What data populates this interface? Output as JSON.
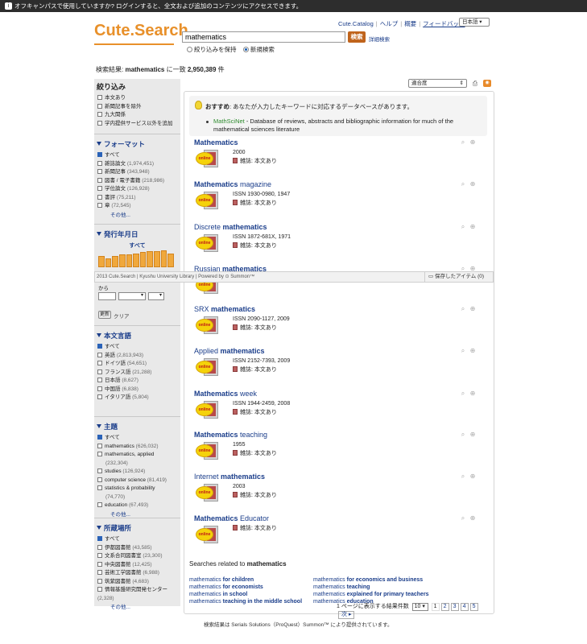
{
  "topbar": {
    "text": "オフキャンパスで使用していますか? ログインすると、全文および追加のコンテンツにアクセスできます。"
  },
  "header": {
    "logo": "Cute.Search",
    "search_value": "mathematics",
    "search_button": "検索",
    "advanced": "詳細検索",
    "radio_keep": "絞り込みを保持",
    "radio_new": "新規検索",
    "nav": [
      "Cute.Catalog",
      "ヘルプ",
      "概要",
      "フィードバック"
    ],
    "lang": "日本語"
  },
  "result_count": {
    "prefix": "検索結果: ",
    "query": "mathematics",
    "mid": " に一致 ",
    "count": "2,950,389",
    "suffix": " 件"
  },
  "sidebar": {
    "refine_title": "絞り込み",
    "refine_items": [
      "本文あり",
      "新聞記事を除外",
      "九大関係",
      "学内提供サービス以外を追加"
    ],
    "format": {
      "title": "フォーマット",
      "items": [
        {
          "label": "すべて",
          "count": "",
          "checked": true
        },
        {
          "label": "雑誌論文",
          "count": "(1,974,451)",
          "checked": false
        },
        {
          "label": "新聞記事",
          "count": "(343,948)",
          "checked": false
        },
        {
          "label": "図書 / 電子書籍",
          "count": "(218,986)",
          "checked": false
        },
        {
          "label": "学位論文",
          "count": "(126,928)",
          "checked": false
        },
        {
          "label": "書評",
          "count": "(75,211)",
          "checked": false
        },
        {
          "label": "章",
          "count": "(72,545)",
          "checked": false
        }
      ],
      "more": "その他..."
    },
    "date": {
      "title": "発行年月日",
      "all": "すべて",
      "from": "から",
      "update": "更新",
      "clear": "クリア",
      "histogram": [
        0.55,
        0.45,
        0.55,
        0.65,
        0.65,
        0.7,
        0.75,
        0.8,
        0.8,
        0.85,
        0.7
      ]
    },
    "language": {
      "title": "本文言語",
      "items": [
        {
          "label": "すべて",
          "count": "",
          "checked": true
        },
        {
          "label": "英語",
          "count": "(2,813,943)",
          "checked": false
        },
        {
          "label": "ドイツ語",
          "count": "(54,651)",
          "checked": false
        },
        {
          "label": "フランス語",
          "count": "(21,288)",
          "checked": false
        },
        {
          "label": "日本語",
          "count": "(8,627)",
          "checked": false
        },
        {
          "label": "中国語",
          "count": "(6,838)",
          "checked": false
        },
        {
          "label": "イタリア語",
          "count": "(5,804)",
          "checked": false
        }
      ]
    },
    "subject": {
      "title": "主題",
      "items": [
        {
          "label": "すべて",
          "count": "",
          "checked": true
        },
        {
          "label": "mathematics",
          "count": "(626,032)",
          "checked": false
        },
        {
          "label": "mathematics, applied",
          "count": "(232,304)",
          "checked": false
        },
        {
          "label": "studies",
          "count": "(126,924)",
          "checked": false
        },
        {
          "label": "computer science",
          "count": "(81,419)",
          "checked": false
        },
        {
          "label": "statistics & probability",
          "count": "(74,770)",
          "checked": false
        },
        {
          "label": "education",
          "count": "(67,493)",
          "checked": false
        }
      ],
      "more": "その他..."
    },
    "location": {
      "title": "所蔵場所",
      "items": [
        {
          "label": "すべて",
          "count": "",
          "checked": true
        },
        {
          "label": "伊都図書館",
          "count": "(43,585)",
          "checked": false
        },
        {
          "label": "文系合同図書室",
          "count": "(23,300)",
          "checked": false
        },
        {
          "label": "中央図書館",
          "count": "(12,425)",
          "checked": false
        },
        {
          "label": "芸術工学図書館",
          "count": "(6,988)",
          "checked": false
        },
        {
          "label": "筑紫図書館",
          "count": "(4,683)",
          "checked": false
        },
        {
          "label": "情報基盤研究開発センター",
          "count": "(2,328)",
          "checked": false
        }
      ],
      "more": "その他..."
    }
  },
  "sort": {
    "value": "適合度"
  },
  "recommend": {
    "head_bold": "おすすめ",
    "head_rest": ": あなたが入力したキーワードに対応するデータベースがあります。",
    "db_name": "MathSciNet",
    "db_desc": " - Database of reviews, abstracts and bibliographic information for much of the mathematical sciences literature"
  },
  "results": [
    {
      "pre": "",
      "bold": "Mathematics",
      "post": "",
      "meta1": "2000",
      "type": "雑誌: 本文あり"
    },
    {
      "pre": "",
      "bold": "Mathematics",
      "post": " magazine",
      "meta1": "ISSN 1930-0980, 1947",
      "type": "雑誌: 本文あり"
    },
    {
      "pre": "Discrete ",
      "bold": "mathematics",
      "post": "",
      "meta1": "ISSN 1872-681X, 1971",
      "type": "雑誌: 本文あり"
    },
    {
      "pre": "Russian ",
      "bold": "mathematics",
      "post": "",
      "meta1": "",
      "type": ""
    },
    {
      "pre": "SRX ",
      "bold": "mathematics",
      "post": "",
      "meta1": "ISSN 2090-1127, 2009",
      "type": "雑誌: 本文あり"
    },
    {
      "pre": "Applied ",
      "bold": "mathematics",
      "post": "",
      "meta1": "ISSN 2152-7393, 2009",
      "type": "雑誌: 本文あり"
    },
    {
      "pre": "",
      "bold": "Mathematics",
      "post": " week",
      "meta1": "ISSN 1944-2459, 2008",
      "type": "雑誌: 本文あり"
    },
    {
      "pre": "",
      "bold": "Mathematics",
      "post": " teaching",
      "meta1": "1955",
      "type": "雑誌: 本文あり"
    },
    {
      "pre": "Internet ",
      "bold": "mathematics",
      "post": "",
      "meta1": "2003",
      "type": "雑誌: 本文あり"
    },
    {
      "pre": "",
      "bold": "Mathematics",
      "post": " Educator",
      "meta1": "",
      "type": "雑誌: 本文あり"
    }
  ],
  "online_badge": "online",
  "footer_bar": {
    "text": "2013 Cute.Search | Kyushu University Library  |  Powered by  ⊙ Summon™",
    "saved": "保存したアイテム (0)"
  },
  "related": {
    "head": "Searches related to ",
    "head_bold": "mathematics",
    "col1": [
      {
        "a": "mathematics",
        "b": " for children"
      },
      {
        "a": "mathematics",
        "b": " for economists"
      },
      {
        "a": "mathematics",
        "b": " in school"
      },
      {
        "a": "mathematics",
        "b": " teaching in the middle school"
      }
    ],
    "col2": [
      {
        "a": "mathematics",
        "b": " for economics and business"
      },
      {
        "a": "mathematics",
        "b": " teaching"
      },
      {
        "a": "mathematics",
        "b": " explained for primary teachers"
      },
      {
        "a": "mathematics",
        "b": " education"
      }
    ]
  },
  "pager": {
    "label": "1 ページに表示する結果件数",
    "per_page": "10",
    "pages": [
      "1",
      "2",
      "3",
      "4",
      "5"
    ],
    "next": "次 ▸"
  },
  "bottom_note": "検索結果は Serials Solutions（ProQuest）Summon™ により提供されています。"
}
